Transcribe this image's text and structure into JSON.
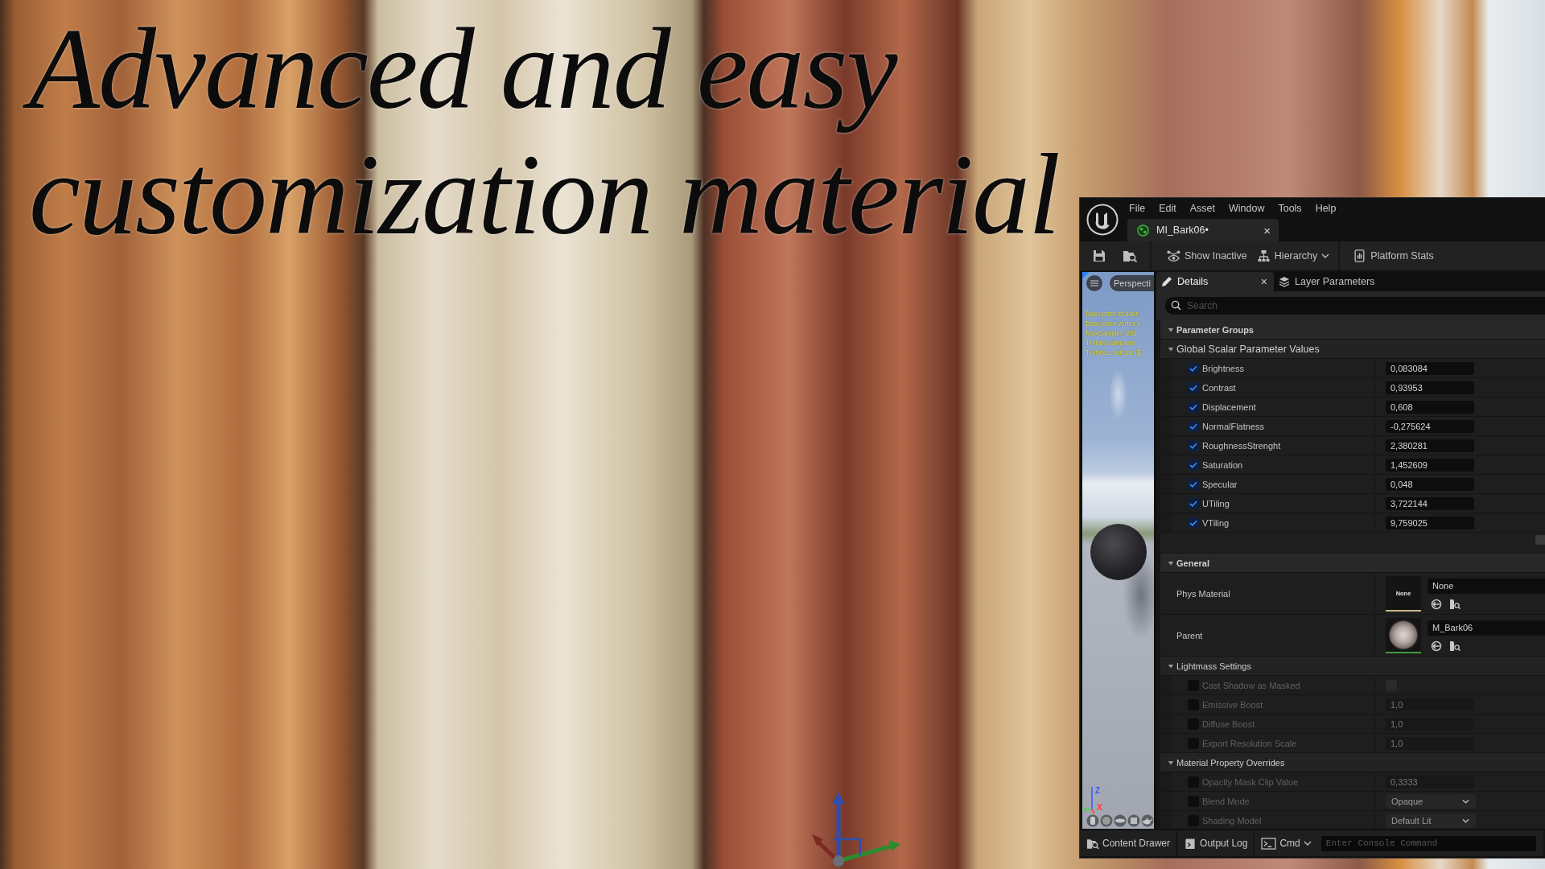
{
  "headline": "Advanced and easy customization material",
  "editor": {
    "menu": [
      "File",
      "Edit",
      "Asset",
      "Window",
      "Tools",
      "Help"
    ],
    "document_tab": {
      "label": "MI_Bark06•",
      "close": "×"
    },
    "toolbar": [
      {
        "label": "Show Inactive",
        "kind": "button"
      },
      {
        "label": "Hierarchy",
        "kind": "dropdown"
      },
      {
        "label": "Platform Stats",
        "kind": "button"
      }
    ],
    "viewport": {
      "view_mode": "Perspecti",
      "stats": [
        "Base pass shader:",
        "Base pass vertex s",
        "MaxSampler: 291",
        "Texture samplers:",
        "Texture Lookups (E"
      ],
      "axes": [
        {
          "label": "Z",
          "color": "#3c5cff"
        },
        {
          "label": "X",
          "color": "#ff3a3a"
        }
      ]
    },
    "panel_tabs": [
      {
        "label": "Details",
        "selected": true,
        "close": "×"
      },
      {
        "label": "Layer Parameters",
        "selected": false
      }
    ],
    "search": {
      "placeholder": "Search"
    },
    "sections": [
      {
        "kind": "category",
        "title": "Parameter Groups",
        "expanded": true
      },
      {
        "kind": "parameter_group",
        "title": "Global Scalar Parameter Values",
        "expanded": true,
        "rows": [
          {
            "kind": "number",
            "label": "Brightness",
            "checked": true,
            "disabled": false,
            "value": "0,083084"
          },
          {
            "kind": "number",
            "label": "Contrast",
            "checked": true,
            "disabled": false,
            "value": "0,93953"
          },
          {
            "kind": "number",
            "label": "Displacement",
            "checked": true,
            "disabled": false,
            "value": "0,608"
          },
          {
            "kind": "number",
            "label": "NormalFlatness",
            "checked": true,
            "disabled": false,
            "value": "-0,275624"
          },
          {
            "kind": "number",
            "label": "RoughnessStrenght",
            "checked": true,
            "disabled": false,
            "value": "2,380281"
          },
          {
            "kind": "number",
            "label": "Saturation",
            "checked": true,
            "disabled": false,
            "value": "1,452609"
          },
          {
            "kind": "number",
            "label": "Specular",
            "checked": true,
            "disabled": false,
            "value": "0,048"
          },
          {
            "kind": "number",
            "label": "UTiling",
            "checked": true,
            "disabled": false,
            "value": "3,722144"
          },
          {
            "kind": "number",
            "label": "VTiling",
            "checked": true,
            "disabled": false,
            "value": "9,759025"
          }
        ]
      },
      {
        "kind": "category",
        "title": "General",
        "expanded": true,
        "rows": [
          {
            "kind": "asset",
            "label": "Phys Material",
            "thumbnail": {
              "kind": "text",
              "text": "None"
            },
            "value": "None",
            "color": "#c9b98a"
          },
          {
            "kind": "asset",
            "label": "Parent",
            "thumbnail": {
              "kind": "preview"
            },
            "value": "M_Bark06",
            "color": "#3f9b3f"
          }
        ]
      },
      {
        "kind": "subgroup",
        "title": "Lightmass Settings",
        "expanded": true,
        "rows": [
          {
            "kind": "toggle",
            "label": "Cast Shadow as Masked",
            "checked": false,
            "disabled": true,
            "value_checked": false
          },
          {
            "kind": "number",
            "label": "Emissive Boost",
            "checked": false,
            "disabled": true,
            "value": "1,0"
          },
          {
            "kind": "number",
            "label": "Diffuse Boost",
            "checked": false,
            "disabled": true,
            "value": "1,0"
          },
          {
            "kind": "number",
            "label": "Export Resolution Scale",
            "checked": false,
            "disabled": true,
            "value": "1,0"
          }
        ]
      },
      {
        "kind": "subgroup",
        "title": "Material Property Overrides",
        "expanded": true,
        "rows": [
          {
            "kind": "number",
            "label": "Opacity Mask Clip Value",
            "checked": false,
            "disabled": true,
            "value": "0,3333"
          },
          {
            "kind": "dropdown",
            "label": "Blend Mode",
            "checked": false,
            "disabled": true,
            "value": "Opaque"
          },
          {
            "kind": "dropdown",
            "label": "Shading Model",
            "checked": false,
            "disabled": true,
            "value": "Default Lit"
          }
        ]
      }
    ],
    "bottom_bar": {
      "buttons": [
        {
          "label": "Content Drawer",
          "kind": "button"
        },
        {
          "label": "Output Log",
          "kind": "button"
        },
        {
          "label": "Cmd",
          "kind": "dropdown"
        }
      ],
      "console": {
        "placeholder": "Enter Console Command"
      }
    }
  }
}
